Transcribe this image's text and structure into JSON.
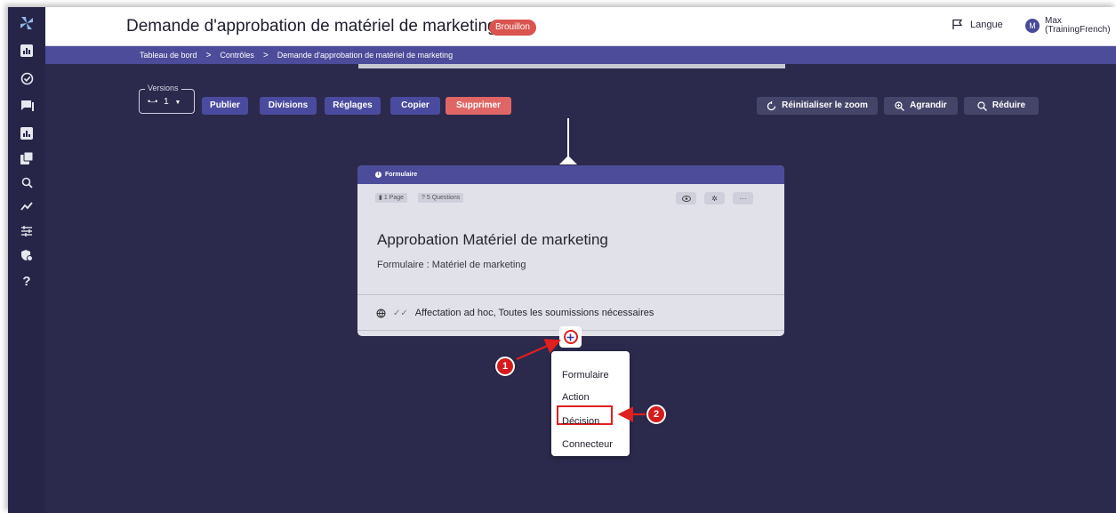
{
  "header": {
    "title": "Demande d'approbation de matériel de marketing",
    "status_badge": "Brouillon",
    "language_label": "Langue",
    "user_initial": "M",
    "user_name": "Max\n(TrainingFrench)"
  },
  "breadcrumb": {
    "items": [
      "Tableau de bord",
      "Contrôles",
      "Demande d'approbation de matériel de marketing"
    ],
    "separator": ">"
  },
  "sidebar": {
    "icons": [
      "logo-icon",
      "dashboard-icon",
      "check-circle-icon",
      "chat-icon",
      "chart-icon",
      "copy-icon",
      "search-icon",
      "trend-icon",
      "sliders-icon",
      "shield-icon",
      "help-icon"
    ]
  },
  "toolbar": {
    "versions_label": "Versions",
    "versions_value": "1",
    "publish_label": "Publier",
    "divisions_label": "Divisions",
    "settings_label": "Réglages",
    "copy_label": "Copier",
    "delete_label": "Supprimer",
    "reset_zoom_label": "Réinitialiser le zoom",
    "zoom_in_label": "Agrandir",
    "zoom_out_label": "Réduire"
  },
  "card": {
    "header_label": "Formulaire",
    "pages_pill": "1 Page",
    "questions_pill": "5 Questions",
    "title": "Approbation Matériel de marketing",
    "subtitle": "Formulaire : Matériel de marketing",
    "footer": "Affectation ad hoc, Toutes les soumissions nécessaires"
  },
  "add_menu": {
    "items": [
      "Formulaire",
      "Action",
      "Décision",
      "Connecteur"
    ],
    "highlighted": "Décision"
  },
  "callouts": {
    "one": "1",
    "two": "2"
  },
  "colors": {
    "canvas": "#2b2a4d",
    "primary_button": "#4a4a9e",
    "danger_button": "#e06666",
    "badge": "#d9534f",
    "callout": "#d41b1b"
  }
}
